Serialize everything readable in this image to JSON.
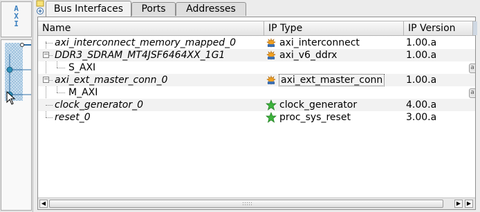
{
  "left_panel": {
    "bus_label_letters": [
      "A",
      "X",
      "I"
    ],
    "bus_color": "#3a7fbf"
  },
  "tabs": [
    {
      "label": "Bus Interfaces",
      "active": true
    },
    {
      "label": "Ports",
      "active": false
    },
    {
      "label": "Addresses",
      "active": false
    }
  ],
  "table": {
    "columns": [
      "Name",
      "IP Type",
      "IP Version"
    ],
    "rows": [
      {
        "name": "axi_interconnect_memory_mapped_0",
        "ip_type": "axi_interconnect",
        "ip_version": "1.00.a",
        "icon": "ip-core-icon",
        "expander": "none"
      },
      {
        "name": "DDR3_SDRAM_MT4JSF6464XX_1G1",
        "ip_type": "axi_v6_ddrx",
        "ip_version": "1.00.a",
        "icon": "ip-core-icon",
        "expander": "minus"
      },
      {
        "name": "S_AXI",
        "ip_type": "",
        "ip_version": "",
        "icon": "",
        "expander": "child"
      },
      {
        "name": "axi_ext_master_conn_0",
        "ip_type": "axi_ext_master_conn",
        "ip_version": "1.00.a",
        "icon": "ip-core-icon",
        "expander": "minus"
      },
      {
        "name": "M_AXI",
        "ip_type": "",
        "ip_version": "",
        "icon": "",
        "expander": "child"
      },
      {
        "name": "clock_generator_0",
        "ip_type": "clock_generator",
        "ip_version": "4.00.a",
        "icon": "star-icon",
        "expander": "none"
      },
      {
        "name": "reset_0",
        "ip_type": "proc_sys_reset",
        "ip_version": "3.00.a",
        "icon": "star-icon",
        "expander": "none"
      }
    ]
  },
  "colors": {
    "ip_icon": "#f0a020",
    "star_icon": "#3cb33c",
    "selection_outline": "#555555"
  }
}
